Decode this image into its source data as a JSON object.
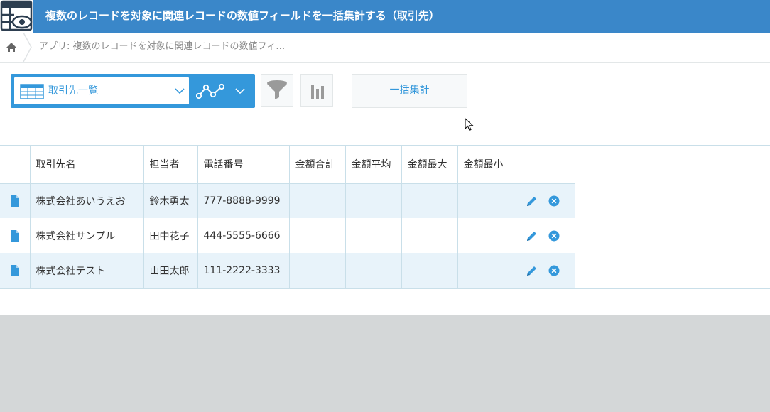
{
  "header": {
    "title": "複数のレコードを対象に関連レコードの数値フィールドを一括集計する（取引先）"
  },
  "breadcrumb": {
    "app_path": "アプリ: 複数のレコードを対象に関連レコードの数値フィ…"
  },
  "toolbar": {
    "view_name": "取引先一覧",
    "bulk_button_label": "一括集計"
  },
  "table": {
    "columns": [
      "取引先名",
      "担当者",
      "電話番号",
      "金額合計",
      "金額平均",
      "金額最大",
      "金額最小"
    ],
    "rows": [
      {
        "name": "株式会社あいうえお",
        "person": "鈴木勇太",
        "phone": "777-8888-9999",
        "sum": "",
        "avg": "",
        "max": "",
        "min": ""
      },
      {
        "name": "株式会社サンプル",
        "person": "田中花子",
        "phone": "444-5555-6666",
        "sum": "",
        "avg": "",
        "max": "",
        "min": ""
      },
      {
        "name": "株式会社テスト",
        "person": "山田太郎",
        "phone": "111-2222-3333",
        "sum": "",
        "avg": "",
        "max": "",
        "min": ""
      }
    ]
  },
  "colors": {
    "header_bg": "#3a87c9",
    "accent": "#3498db",
    "row_alt": "#e8f3fa",
    "page_bg": "#d4d7d8"
  },
  "icons": {
    "app": "app-table-eye-icon",
    "home": "home-icon",
    "view": "table-grid-icon",
    "graph": "line-graph-icon",
    "filter": "filter-funnel-icon",
    "chart": "bar-chart-icon",
    "record": "document-icon",
    "edit": "pencil-icon",
    "delete": "close-circle-icon"
  }
}
